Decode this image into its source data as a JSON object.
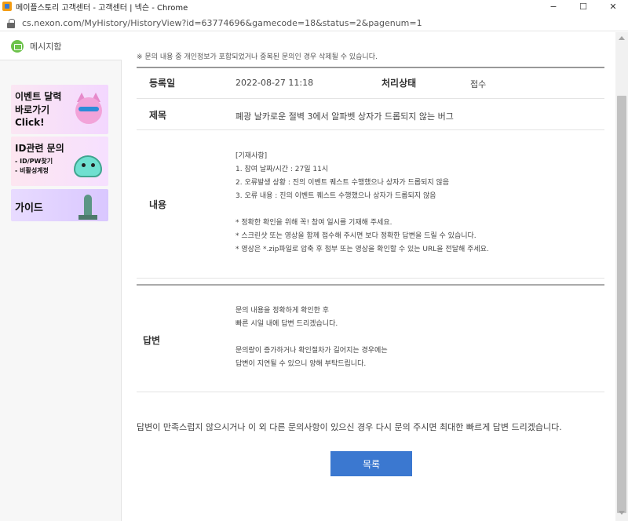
{
  "window": {
    "title": "메이플스토리 고객센터 - 고객센터 | 넥슨 - Chrome",
    "minimize": "−",
    "maximize": "☐",
    "close": "✕"
  },
  "address": {
    "url": "cs.nexon.com/MyHistory/HistoryView?id=63774696&gamecode=18&status=2&pagenum=1"
  },
  "sidebar": {
    "message_box": "메시지함",
    "banners": [
      {
        "lines": [
          "이벤트 달력",
          "바로가기",
          "Click!"
        ]
      },
      {
        "lines": [
          "ID관련 문의",
          "- ID/PW찾기",
          "- 비활성계정"
        ]
      },
      {
        "lines": [
          "가이드"
        ]
      }
    ]
  },
  "main": {
    "notice": "※ 문의 내용 중 개인정보가 포함되었거나 중복된 문의인 경우 삭제될 수 있습니다.",
    "registered_label": "등록일",
    "registered_value": "2022-08-27 11:18",
    "status_label": "처리상태",
    "status_value": "접수",
    "subject_label": "제목",
    "subject_value": "폐광 날카로운 절벽 3에서 알파벳 상자가 드롭되지 않는 버그",
    "content_label": "내용",
    "content_lines": [
      "[기재사항]",
      "1. 참여 날짜/시간 : 27일 11시",
      "2. 오류발생 상황 : 진의 이벤트 퀘스트 수행했으나 상자가 드롭되지 않음",
      "3. 오류 내용 : 진의 이벤트 퀘스트 수행했으나 상자가 드롭되지 않음",
      "",
      "* 정확한 확인을 위해 꼭! 참여 일시를 기재해 주세요.",
      "* 스크린샷 또는 영상을 함께 접수해 주시면 보다 정확한 답변을 드릴 수 있습니다.",
      "* 영상은 *.zip파일로 압축 후 첨부 또는 영상을 확인할 수 있는 URL을 전달해 주세요."
    ],
    "answer_label": "답변",
    "answer_lines": [
      "문의 내용을 정확하게 확인한 후",
      "빠른 시일 내에 답변 드리겠습니다.",
      "",
      "문의량이 증가하거나 확인절차가 길어지는 경우에는",
      "답변이 지연될 수 있으니 양해 부탁드립니다."
    ],
    "bottom_note": "답변이 만족스럽지 않으시거나 이 외 다른 문의사항이 있으신 경우 다시 문의 주시면 최대한 빠르게 답변 드리겠습니다.",
    "list_button": "목록"
  },
  "colors": {
    "primary_button": "#3b78d0",
    "message_icon": "#6cc24a"
  }
}
